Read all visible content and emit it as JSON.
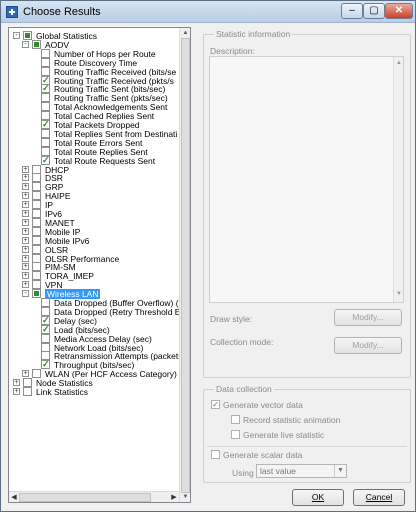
{
  "window": {
    "title": "Choose Results",
    "min": "–",
    "max": "▢",
    "close": "✕"
  },
  "tree": [
    {
      "label": "Global Statistics",
      "level": 0,
      "expander": "-",
      "checked": "partial"
    },
    {
      "label": "AODV",
      "level": 1,
      "expander": "-",
      "checked": "partial"
    },
    {
      "label": "Number of Hops per Route",
      "level": 2,
      "checked": false
    },
    {
      "label": "Route Discovery Time",
      "level": 2,
      "checked": false
    },
    {
      "label": "Routing Traffic Received (bits/se",
      "level": 2,
      "checked": false
    },
    {
      "label": "Routing Traffic Received (pkts/s",
      "level": 2,
      "checked": true
    },
    {
      "label": "Routing Traffic Sent (bits/sec)",
      "level": 2,
      "checked": true
    },
    {
      "label": "Routing Traffic Sent (pkts/sec)",
      "level": 2,
      "checked": false
    },
    {
      "label": "Total Acknowledgements Sent",
      "level": 2,
      "checked": false
    },
    {
      "label": "Total Cached Replies Sent",
      "level": 2,
      "checked": false
    },
    {
      "label": "Total Packets Dropped",
      "level": 2,
      "checked": true
    },
    {
      "label": "Total Replies Sent from Destinati",
      "level": 2,
      "checked": false
    },
    {
      "label": "Total Route Errors Sent",
      "level": 2,
      "checked": false
    },
    {
      "label": "Total Route Replies Sent",
      "level": 2,
      "checked": false
    },
    {
      "label": "Total Route Requests Sent",
      "level": 2,
      "checked": true
    },
    {
      "label": "DHCP",
      "level": 1,
      "expander": "+",
      "checked": false
    },
    {
      "label": "DSR",
      "level": 1,
      "expander": "+",
      "checked": false
    },
    {
      "label": "GRP",
      "level": 1,
      "expander": "+",
      "checked": false
    },
    {
      "label": "HAIPE",
      "level": 1,
      "expander": "+",
      "checked": false
    },
    {
      "label": "IP",
      "level": 1,
      "expander": "+",
      "checked": false
    },
    {
      "label": "IPv6",
      "level": 1,
      "expander": "+",
      "checked": false
    },
    {
      "label": "MANET",
      "level": 1,
      "expander": "+",
      "checked": false
    },
    {
      "label": "Mobile IP",
      "level": 1,
      "expander": "+",
      "checked": false
    },
    {
      "label": "Mobile IPv6",
      "level": 1,
      "expander": "+",
      "checked": false
    },
    {
      "label": "OLSR",
      "level": 1,
      "expander": "+",
      "checked": false
    },
    {
      "label": "OLSR Performance",
      "level": 1,
      "expander": "+",
      "checked": false
    },
    {
      "label": "PIM-SM",
      "level": 1,
      "expander": "+",
      "checked": false
    },
    {
      "label": "TORA_IMEP",
      "level": 1,
      "expander": "+",
      "checked": false
    },
    {
      "label": "VPN",
      "level": 1,
      "expander": "+",
      "checked": false
    },
    {
      "label": "Wireless LAN",
      "level": 1,
      "expander": "-",
      "checked": "partial",
      "selected": true
    },
    {
      "label": "Data Dropped (Buffer Overflow) (l",
      "level": 2,
      "checked": false
    },
    {
      "label": "Data Dropped (Retry Threshold E",
      "level": 2,
      "checked": false
    },
    {
      "label": "Delay (sec)",
      "level": 2,
      "checked": true
    },
    {
      "label": "Load (bits/sec)",
      "level": 2,
      "checked": true
    },
    {
      "label": "Media Access Delay (sec)",
      "level": 2,
      "checked": false
    },
    {
      "label": "Network Load (bits/sec)",
      "level": 2,
      "checked": false
    },
    {
      "label": "Retransmission Attempts (packets",
      "level": 2,
      "checked": false
    },
    {
      "label": "Throughput (bits/sec)",
      "level": 2,
      "checked": true
    },
    {
      "label": "WLAN (Per HCF Access Category)",
      "level": 1,
      "expander": "+",
      "checked": false
    },
    {
      "label": "Node Statistics",
      "level": 0,
      "expander": "+",
      "checked": false
    },
    {
      "label": "Link Statistics",
      "level": 0,
      "expander": "+",
      "checked": false
    }
  ],
  "stats": {
    "group_title": "Statistic information",
    "description_label": "Description:",
    "draw_style_label": "Draw style:",
    "draw_style_button": "Modify...",
    "collection_mode_label": "Collection mode:",
    "collection_mode_button": "Modify..."
  },
  "data_collection": {
    "group_title": "Data collection",
    "generate_vector": "Generate vector data",
    "generate_vector_checked": true,
    "record_animation": "Record statistic animation",
    "record_animation_checked": false,
    "generate_live": "Generate live statistic",
    "generate_live_checked": false,
    "generate_scalar": "Generate scalar data",
    "generate_scalar_checked": false,
    "using_label": "Using",
    "using_value": "last value"
  },
  "buttons": {
    "ok": "OK",
    "cancel": "Cancel"
  }
}
